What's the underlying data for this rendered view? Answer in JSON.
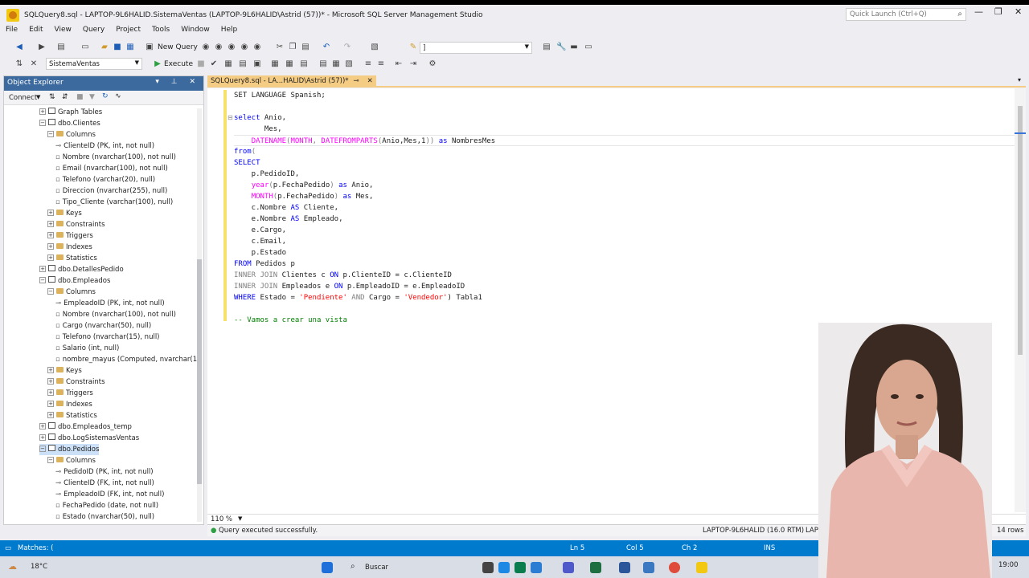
{
  "window": {
    "title": "SQLQuery8.sql - LAPTOP-9L6HALID.SistemaVentas (LAPTOP-9L6HALID\\Astrid (57))* - Microsoft SQL Server Management Studio",
    "quick_launch": "Quick Launch (Ctrl+Q)"
  },
  "menu": [
    "File",
    "Edit",
    "View",
    "Query",
    "Project",
    "Tools",
    "Window",
    "Help"
  ],
  "toolbar": {
    "new_query": "New Query",
    "database": "SistemaVentas",
    "execute": "Execute",
    "search_combo": "]"
  },
  "object_explorer": {
    "title": "Object Explorer",
    "connect": "Connect",
    "nodes": [
      {
        "text": "Graph Tables"
      },
      {
        "text": "dbo.Clientes"
      },
      {
        "text": "Columns"
      },
      {
        "text": "ClienteID (PK, int, not null)"
      },
      {
        "text": "Nombre (nvarchar(100), not null)"
      },
      {
        "text": "Email (nvarchar(100), not null)"
      },
      {
        "text": "Telefono (varchar(20), null)"
      },
      {
        "text": "Direccion (nvarchar(255), null)"
      },
      {
        "text": "Tipo_Cliente (varchar(100), null)"
      },
      {
        "text": "Keys"
      },
      {
        "text": "Constraints"
      },
      {
        "text": "Triggers"
      },
      {
        "text": "Indexes"
      },
      {
        "text": "Statistics"
      },
      {
        "text": "dbo.DetallesPedido"
      },
      {
        "text": "dbo.Empleados"
      },
      {
        "text": "Columns"
      },
      {
        "text": "EmpleadoID (PK, int, not null)"
      },
      {
        "text": "Nombre (nvarchar(100), not null)"
      },
      {
        "text": "Cargo (nvarchar(50), null)"
      },
      {
        "text": "Telefono (nvarchar(15), null)"
      },
      {
        "text": "Salario (int, null)"
      },
      {
        "text": "nombre_mayus (Computed, nvarchar(1"
      },
      {
        "text": "Keys"
      },
      {
        "text": "Constraints"
      },
      {
        "text": "Triggers"
      },
      {
        "text": "Indexes"
      },
      {
        "text": "Statistics"
      },
      {
        "text": "dbo.Empleados_temp"
      },
      {
        "text": "dbo.LogSistemasVentas"
      },
      {
        "text": "dbo.Pedidos"
      },
      {
        "text": "Columns"
      },
      {
        "text": "PedidoID (PK, int, not null)"
      },
      {
        "text": "ClienteID (FK, int, not null)"
      },
      {
        "text": "EmpleadoID (FK, int, not null)"
      },
      {
        "text": "FechaPedido (date, not null)"
      },
      {
        "text": "Estado (nvarchar(50), null)"
      }
    ]
  },
  "editor": {
    "tab_label": "SQLQuery8.sql - LA...HALID\\Astrid (57))*",
    "lines": [
      [
        {
          "t": "SET LANGUAGE Spanish;",
          "c": ""
        }
      ],
      [],
      [
        {
          "t": "select",
          "c": "kw"
        },
        {
          "t": " Anio,",
          "c": ""
        }
      ],
      [
        {
          "t": "       Mes,",
          "c": ""
        }
      ],
      [
        {
          "t": "    ",
          "c": ""
        },
        {
          "t": "DATENAME",
          "c": "fn"
        },
        {
          "t": "(",
          "c": "gr"
        },
        {
          "t": "MONTH",
          "c": "fn"
        },
        {
          "t": ", ",
          "c": "gr"
        },
        {
          "t": "DATEFROMPARTS",
          "c": "fn"
        },
        {
          "t": "(",
          "c": "gr"
        },
        {
          "t": "Anio,Mes,1",
          "c": ""
        },
        {
          "t": ")) ",
          "c": "gr"
        },
        {
          "t": "as",
          "c": "kw"
        },
        {
          "t": " NombresMes",
          "c": ""
        }
      ],
      [
        {
          "t": "from",
          "c": "kw"
        },
        {
          "t": "(",
          "c": "gr"
        }
      ],
      [
        {
          "t": "SELECT",
          "c": "kw"
        }
      ],
      [
        {
          "t": "    p.PedidoID,",
          "c": ""
        }
      ],
      [
        {
          "t": "    ",
          "c": ""
        },
        {
          "t": "year",
          "c": "fn"
        },
        {
          "t": "(",
          "c": "gr"
        },
        {
          "t": "p.FechaPedido",
          "c": ""
        },
        {
          "t": ")",
          "c": "gr"
        },
        {
          "t": " as ",
          "c": "kw"
        },
        {
          "t": "Anio,",
          "c": ""
        }
      ],
      [
        {
          "t": "    ",
          "c": ""
        },
        {
          "t": "MONTH",
          "c": "fn"
        },
        {
          "t": "(",
          "c": "gr"
        },
        {
          "t": "p.FechaPedido",
          "c": ""
        },
        {
          "t": ")",
          "c": "gr"
        },
        {
          "t": " as ",
          "c": "kw"
        },
        {
          "t": "Mes,",
          "c": ""
        }
      ],
      [
        {
          "t": "    c.Nombre ",
          "c": ""
        },
        {
          "t": "AS",
          "c": "kw"
        },
        {
          "t": " Cliente,",
          "c": ""
        }
      ],
      [
        {
          "t": "    e.Nombre ",
          "c": ""
        },
        {
          "t": "AS",
          "c": "kw"
        },
        {
          "t": " Empleado,",
          "c": ""
        }
      ],
      [
        {
          "t": "    e.Cargo,",
          "c": ""
        }
      ],
      [
        {
          "t": "    c.Email,",
          "c": ""
        }
      ],
      [
        {
          "t": "    p.Estado",
          "c": ""
        }
      ],
      [
        {
          "t": "FROM",
          "c": "kw"
        },
        {
          "t": " Pedidos p",
          "c": ""
        }
      ],
      [
        {
          "t": "INNER JOIN",
          "c": "gr"
        },
        {
          "t": " Clientes c ",
          "c": ""
        },
        {
          "t": "ON",
          "c": "kw"
        },
        {
          "t": " p.ClienteID = c.ClienteID",
          "c": ""
        }
      ],
      [
        {
          "t": "INNER JOIN",
          "c": "gr"
        },
        {
          "t": " Empleados e ",
          "c": ""
        },
        {
          "t": "ON",
          "c": "kw"
        },
        {
          "t": " p.EmpleadoID = e.EmpleadoID",
          "c": ""
        }
      ],
      [
        {
          "t": "WHERE",
          "c": "kw"
        },
        {
          "t": " Estado = ",
          "c": ""
        },
        {
          "t": "'Pendiente'",
          "c": "str"
        },
        {
          "t": " AND ",
          "c": "gr"
        },
        {
          "t": "Cargo = ",
          "c": ""
        },
        {
          "t": "'Vendedor'",
          "c": "str"
        },
        {
          "t": ") Tabla1",
          "c": ""
        }
      ],
      [],
      [
        {
          "t": "-- Vamos a crear una vista",
          "c": "cm"
        }
      ]
    ],
    "zoom": "110 %"
  },
  "query_status": {
    "message": "Query executed successfully.",
    "server": "LAPTOP-9L6HALID (16.0 RTM)",
    "server_cut": "LAP",
    "rows": "14 rows"
  },
  "statusbar": {
    "matches": "Matches: (",
    "ln": "Ln 5",
    "col": "Col 5",
    "ch": "Ch 2",
    "ins": "INS"
  },
  "taskbar": {
    "weather": "18°C",
    "search": "Buscar",
    "time": "19:00"
  },
  "colors": {
    "accent": "#007acc",
    "tab": "#f5cc84",
    "oe_header": "#3c6a9e"
  }
}
